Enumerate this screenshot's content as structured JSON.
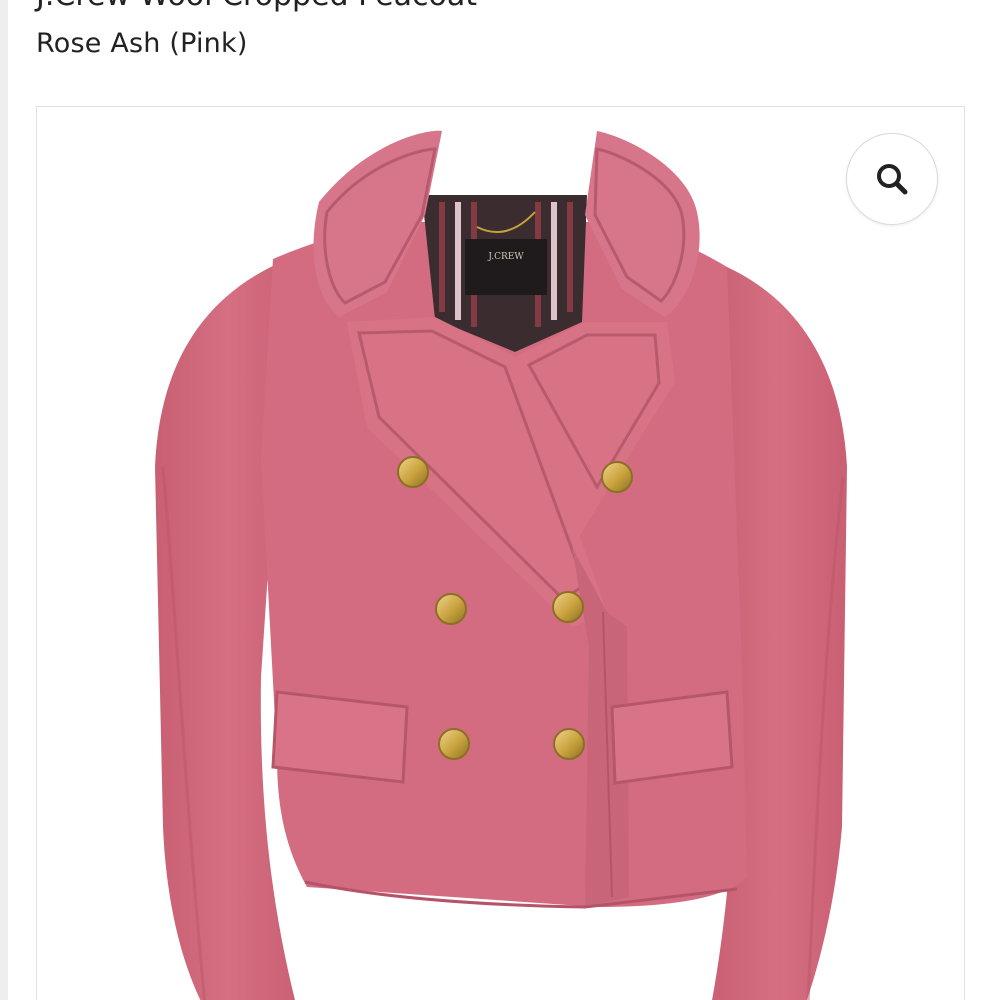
{
  "product": {
    "title_fragment": "J.Crew Wool Cropped Peacoat",
    "variant_label": "Rose Ash (Pink)",
    "brand_label": "J.CREW"
  },
  "gallery": {
    "zoom_icon": "search-icon"
  },
  "colors": {
    "jacket": "#d66f82",
    "buttons": "#c9a23d"
  }
}
